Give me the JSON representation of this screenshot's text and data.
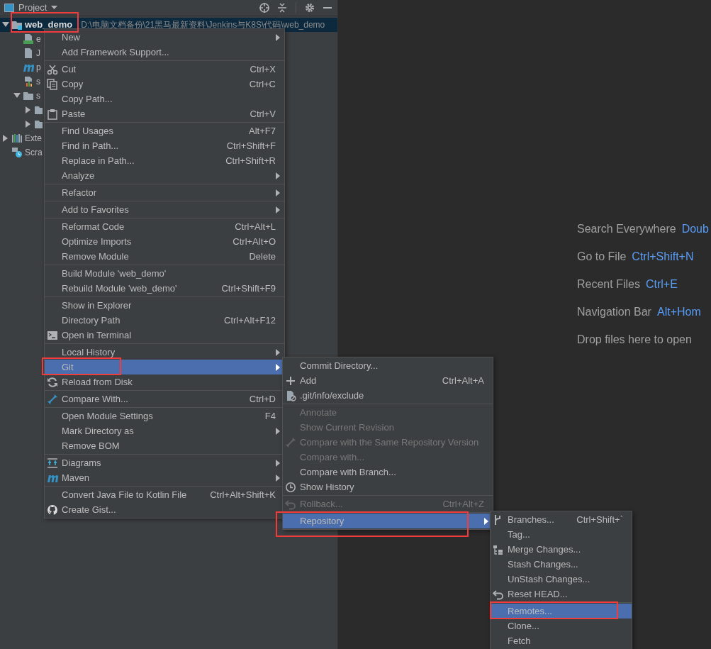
{
  "project_panel": {
    "title": "Project",
    "tree": [
      {
        "label": "web_demo",
        "path": "D:\\电脑文档备份\\21黑马最新资料\\Jenkins与K8S\\代码\\web_demo",
        "selected": true,
        "marked": true,
        "expanded": true,
        "children": [
          {
            "label": "e",
            "selected": false,
            "marked": false
          },
          {
            "label": "J",
            "selected": false,
            "marked": false
          },
          {
            "label": "p",
            "selected": false,
            "marked": false
          },
          {
            "label": "s",
            "selected": false,
            "marked": false
          },
          {
            "label": "s",
            "selected": false,
            "marked": false,
            "expanded": true,
            "children": [
              {
                "selected": false,
                "marked": false,
                "expanded": false
              },
              {
                "selected": false,
                "marked": false,
                "expanded": false
              }
            ]
          }
        ]
      },
      {
        "label": "Exte",
        "selected": false,
        "marked": false,
        "expanded": false
      },
      {
        "label": "Scra",
        "selected": false,
        "marked": false
      }
    ]
  },
  "context_menu": {
    "groups": [
      [
        {
          "label": "New",
          "kind": "submenu",
          "selected": false,
          "disabled": false,
          "marked": false
        },
        {
          "label": "Add Framework Support...",
          "kind": "action",
          "selected": false,
          "disabled": false,
          "marked": false
        }
      ],
      [
        {
          "label": "Cut",
          "shortcut": "Ctrl+X",
          "kind": "action",
          "selected": false,
          "disabled": false,
          "marked": false
        },
        {
          "label": "Copy",
          "shortcut": "Ctrl+C",
          "kind": "action",
          "selected": false,
          "disabled": false,
          "marked": false
        },
        {
          "label": "Copy Path...",
          "kind": "action",
          "selected": false,
          "disabled": false,
          "marked": false
        },
        {
          "label": "Paste",
          "shortcut": "Ctrl+V",
          "kind": "action",
          "selected": false,
          "disabled": false,
          "marked": false
        }
      ],
      [
        {
          "label": "Find Usages",
          "shortcut": "Alt+F7",
          "kind": "action",
          "selected": false,
          "disabled": false,
          "marked": false
        },
        {
          "label": "Find in Path...",
          "shortcut": "Ctrl+Shift+F",
          "kind": "action",
          "selected": false,
          "disabled": false,
          "marked": false
        },
        {
          "label": "Replace in Path...",
          "shortcut": "Ctrl+Shift+R",
          "kind": "action",
          "selected": false,
          "disabled": false,
          "marked": false
        },
        {
          "label": "Analyze",
          "kind": "submenu",
          "selected": false,
          "disabled": false,
          "marked": false
        }
      ],
      [
        {
          "label": "Refactor",
          "kind": "submenu",
          "selected": false,
          "disabled": false,
          "marked": false
        }
      ],
      [
        {
          "label": "Add to Favorites",
          "kind": "submenu",
          "selected": false,
          "disabled": false,
          "marked": false
        }
      ],
      [
        {
          "label": "Reformat Code",
          "shortcut": "Ctrl+Alt+L",
          "kind": "action",
          "selected": false,
          "disabled": false,
          "marked": false
        },
        {
          "label": "Optimize Imports",
          "shortcut": "Ctrl+Alt+O",
          "kind": "action",
          "selected": false,
          "disabled": false,
          "marked": false
        },
        {
          "label": "Remove Module",
          "shortcut": "Delete",
          "kind": "action",
          "selected": false,
          "disabled": false,
          "marked": false
        }
      ],
      [
        {
          "label": "Build Module 'web_demo'",
          "kind": "action",
          "selected": false,
          "disabled": false,
          "marked": false
        },
        {
          "label": "Rebuild Module 'web_demo'",
          "shortcut": "Ctrl+Shift+F9",
          "kind": "action",
          "selected": false,
          "disabled": false,
          "marked": false
        }
      ],
      [
        {
          "label": "Show in Explorer",
          "kind": "action",
          "selected": false,
          "disabled": false,
          "marked": false
        },
        {
          "label": "Directory Path",
          "shortcut": "Ctrl+Alt+F12",
          "kind": "action",
          "selected": false,
          "disabled": false,
          "marked": false
        },
        {
          "label": "Open in Terminal",
          "kind": "action",
          "selected": false,
          "disabled": false,
          "marked": false
        }
      ],
      [
        {
          "label": "Local History",
          "kind": "submenu",
          "selected": false,
          "disabled": false,
          "marked": false
        },
        {
          "label": "Git",
          "kind": "submenu",
          "selected": true,
          "disabled": false,
          "marked": true
        },
        {
          "label": "Reload from Disk",
          "kind": "action",
          "selected": false,
          "disabled": false,
          "marked": false
        }
      ],
      [
        {
          "label": "Compare With...",
          "shortcut": "Ctrl+D",
          "kind": "action",
          "selected": false,
          "disabled": false,
          "marked": false
        }
      ],
      [
        {
          "label": "Open Module Settings",
          "shortcut": "F4",
          "kind": "action",
          "selected": false,
          "disabled": false,
          "marked": false
        },
        {
          "label": "Mark Directory as",
          "kind": "submenu",
          "selected": false,
          "disabled": false,
          "marked": false
        },
        {
          "label": "Remove BOM",
          "kind": "action",
          "selected": false,
          "disabled": false,
          "marked": false
        }
      ],
      [
        {
          "label": "Diagrams",
          "kind": "submenu",
          "selected": false,
          "disabled": false,
          "marked": false
        },
        {
          "label": "Maven",
          "kind": "submenu",
          "selected": false,
          "disabled": false,
          "marked": false
        }
      ],
      [
        {
          "label": "Convert Java File to Kotlin File",
          "shortcut": "Ctrl+Alt+Shift+K",
          "kind": "action",
          "selected": false,
          "disabled": false,
          "marked": false
        },
        {
          "label": "Create Gist...",
          "kind": "action",
          "selected": false,
          "disabled": false,
          "marked": false
        }
      ]
    ]
  },
  "git_menu": {
    "groups": [
      [
        {
          "label": "Commit Directory...",
          "kind": "action",
          "selected": false,
          "disabled": false,
          "marked": false
        },
        {
          "label": "Add",
          "shortcut": "Ctrl+Alt+A",
          "kind": "action",
          "selected": false,
          "disabled": false,
          "marked": false
        },
        {
          "label": ".git/info/exclude",
          "kind": "action",
          "selected": false,
          "disabled": false,
          "marked": false
        }
      ],
      [
        {
          "label": "Annotate",
          "kind": "action",
          "selected": false,
          "disabled": true,
          "marked": false
        },
        {
          "label": "Show Current Revision",
          "kind": "action",
          "selected": false,
          "disabled": true,
          "marked": false
        },
        {
          "label": "Compare with the Same Repository Version",
          "kind": "action",
          "selected": false,
          "disabled": true,
          "marked": false
        },
        {
          "label": "Compare with...",
          "kind": "action",
          "selected": false,
          "disabled": true,
          "marked": false
        },
        {
          "label": "Compare with Branch...",
          "kind": "action",
          "selected": false,
          "disabled": false,
          "marked": false
        },
        {
          "label": "Show History",
          "kind": "action",
          "selected": false,
          "disabled": false,
          "marked": false
        }
      ],
      [
        {
          "label": "Rollback...",
          "shortcut": "Ctrl+Alt+Z",
          "kind": "action",
          "selected": false,
          "disabled": true,
          "marked": false
        }
      ],
      [
        {
          "label": "Repository",
          "kind": "submenu",
          "selected": true,
          "disabled": false,
          "marked": true
        }
      ]
    ]
  },
  "repository_menu": {
    "groups": [
      [
        {
          "label": "Branches...",
          "shortcut": "Ctrl+Shift+`",
          "kind": "action",
          "selected": false,
          "disabled": false,
          "marked": false
        },
        {
          "label": "Tag...",
          "kind": "action",
          "selected": false,
          "disabled": false,
          "marked": false
        },
        {
          "label": "Merge Changes...",
          "kind": "action",
          "selected": false,
          "disabled": false,
          "marked": false
        },
        {
          "label": "Stash Changes...",
          "kind": "action",
          "selected": false,
          "disabled": false,
          "marked": false
        },
        {
          "label": "UnStash Changes...",
          "kind": "action",
          "selected": false,
          "disabled": false,
          "marked": false
        },
        {
          "label": "Reset HEAD...",
          "kind": "action",
          "selected": false,
          "disabled": false,
          "marked": false
        }
      ],
      [
        {
          "label": "Remotes...",
          "kind": "action",
          "selected": true,
          "disabled": false,
          "marked": true
        },
        {
          "label": "Clone...",
          "kind": "action",
          "selected": false,
          "disabled": false,
          "marked": false
        },
        {
          "label": "Fetch",
          "kind": "action",
          "selected": false,
          "disabled": false,
          "marked": false
        }
      ]
    ]
  },
  "editor_hints": [
    {
      "label": "Search Everywhere",
      "shortcut": "Doub"
    },
    {
      "label": "Go to File",
      "shortcut": "Ctrl+Shift+N"
    },
    {
      "label": "Recent Files",
      "shortcut": "Ctrl+E"
    },
    {
      "label": "Navigation Bar",
      "shortcut": "Alt+Hom"
    },
    {
      "label": "Drop files here to open"
    }
  ]
}
